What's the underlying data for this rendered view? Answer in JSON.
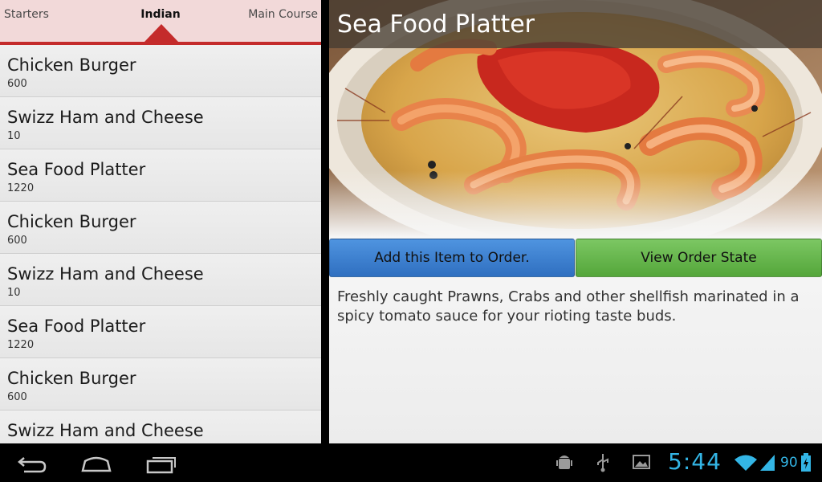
{
  "tabs": [
    {
      "label": "Starters"
    },
    {
      "label": "Indian"
    },
    {
      "label": "Main Course"
    }
  ],
  "menu_items": [
    {
      "name": "Chicken Burger",
      "price": "600"
    },
    {
      "name": "Swizz Ham and Cheese",
      "price": "10"
    },
    {
      "name": "Sea Food Platter",
      "price": "1220"
    },
    {
      "name": "Chicken Burger",
      "price": "600"
    },
    {
      "name": "Swizz Ham and Cheese",
      "price": "10"
    },
    {
      "name": "Sea Food Platter",
      "price": "1220"
    },
    {
      "name": "Chicken Burger",
      "price": "600"
    },
    {
      "name": "Swizz Ham and Cheese",
      "price": ""
    }
  ],
  "detail": {
    "title": "Sea Food Platter",
    "add_button": "Add this Item to Order.",
    "view_button": "View Order State",
    "description": "Freshly caught Prawns, Crabs and other shellfish marinated in a spicy tomato sauce for your rioting taste buds."
  },
  "status_bar": {
    "time": "5:44",
    "battery": "90"
  },
  "colors": {
    "tab_accent": "#c42b2b",
    "tab_bg": "#f2d9d9",
    "add_button": "#3b7fd1",
    "view_button": "#62b045",
    "status_blue": "#33b5e5"
  },
  "icons": [
    "back-icon",
    "home-icon",
    "recent-apps-icon",
    "android-debug-icon",
    "usb-icon",
    "gallery-icon",
    "wifi-icon",
    "signal-icon",
    "battery-icon"
  ]
}
